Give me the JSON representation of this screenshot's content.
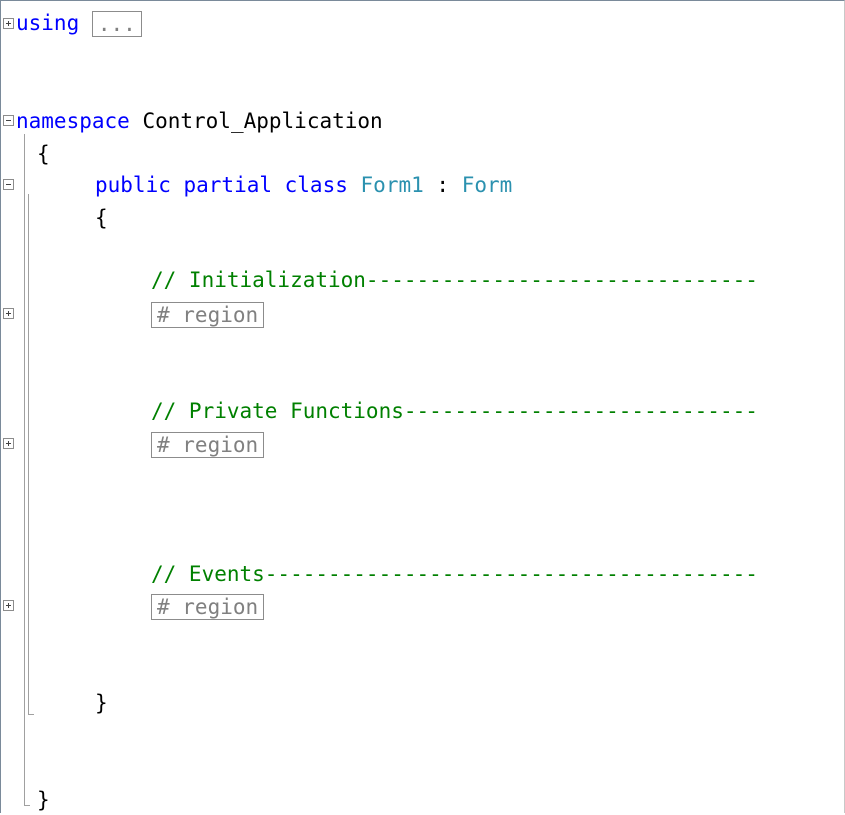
{
  "code": {
    "using_keyword": "using",
    "using_collapsed": "...",
    "namespace_keyword": "namespace",
    "namespace_name": "Control_Application",
    "open_brace_ns": "{",
    "class_modifiers": "public partial class",
    "class_name": "Form1",
    "colon": " : ",
    "base_class": "Form",
    "open_brace_class": "{",
    "comment_init": "// Initialization-------------------------------",
    "region_1": "# region",
    "comment_private": "// Private Functions----------------------------",
    "region_2": "# region",
    "comment_events": "// Events---------------------------------------",
    "region_3": "# region",
    "close_brace_class": "}",
    "close_brace_ns": "}"
  },
  "colors": {
    "keyword": "#0000ff",
    "type": "#2b91af",
    "comment": "#008000",
    "collapsed_text": "#808080"
  },
  "icons": [
    "plus-box-icon",
    "minus-box-icon"
  ]
}
